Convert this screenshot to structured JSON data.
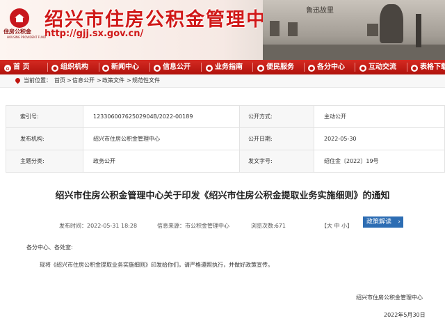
{
  "header": {
    "title": "绍兴市住房公积金管理中心",
    "url": "http://gjj.sx.gov.cn/",
    "logo_cn": "住房公积金",
    "logo_en": "HOUSING PROVIDENT FUND",
    "photo_sign": "鲁迅故里"
  },
  "nav": [
    {
      "label": "首 页",
      "icon": "home-icon"
    },
    {
      "label": "组织机构",
      "icon": "org-icon"
    },
    {
      "label": "新闻中心",
      "icon": "news-icon"
    },
    {
      "label": "信息公开",
      "icon": "info-icon"
    },
    {
      "label": "业务指南",
      "icon": "guide-icon"
    },
    {
      "label": "便民服务",
      "icon": "service-icon"
    },
    {
      "label": "各分中心",
      "icon": "branch-icon"
    },
    {
      "label": "互动交流",
      "icon": "chat-icon"
    },
    {
      "label": "表格下载",
      "icon": "download-icon"
    }
  ],
  "breadcrumb": {
    "prefix": "当前位置：",
    "items": [
      "首页",
      "信息公开",
      "政策文件",
      "规范性文件"
    ],
    "sep": ">"
  },
  "meta": {
    "index_label": "索引号:",
    "index_value": "12330600762502904B/2022-00189",
    "method_label": "公开方式:",
    "method_value": "主动公开",
    "org_label": "发布机构:",
    "org_value": "绍兴市住房公积金管理中心",
    "date_label": "公开日期:",
    "date_value": "2022-05-30",
    "category_label": "主题分类:",
    "category_value": "政务公开",
    "docno_label": "发文字号:",
    "docno_value": "绍住金〔2022〕19号"
  },
  "article": {
    "title": "绍兴市住房公积金管理中心关于印发《绍兴市住房公积金提取业务实施细则》的通知",
    "publish_time": "发布时间：2022-05-31 18:28",
    "source": "信息来源：市公积金管理中心",
    "views": "浏览次数:671",
    "font_size": "【大 中 小】",
    "jiedu": "政策解读",
    "jiedu_arrow": "›",
    "salutation": "各分中心、各处室:",
    "paragraph": "现将《绍兴市住房公积金提取业务实施细则》印发给你们，请严格遵照执行，并做好政策宣传。",
    "sign_org": "绍兴市住房公积金管理中心",
    "sign_date": "2022年5月30日"
  },
  "colors": {
    "nav_red": "#c0150f",
    "title_red": "#d01818",
    "button_blue": "#2d6db3"
  }
}
